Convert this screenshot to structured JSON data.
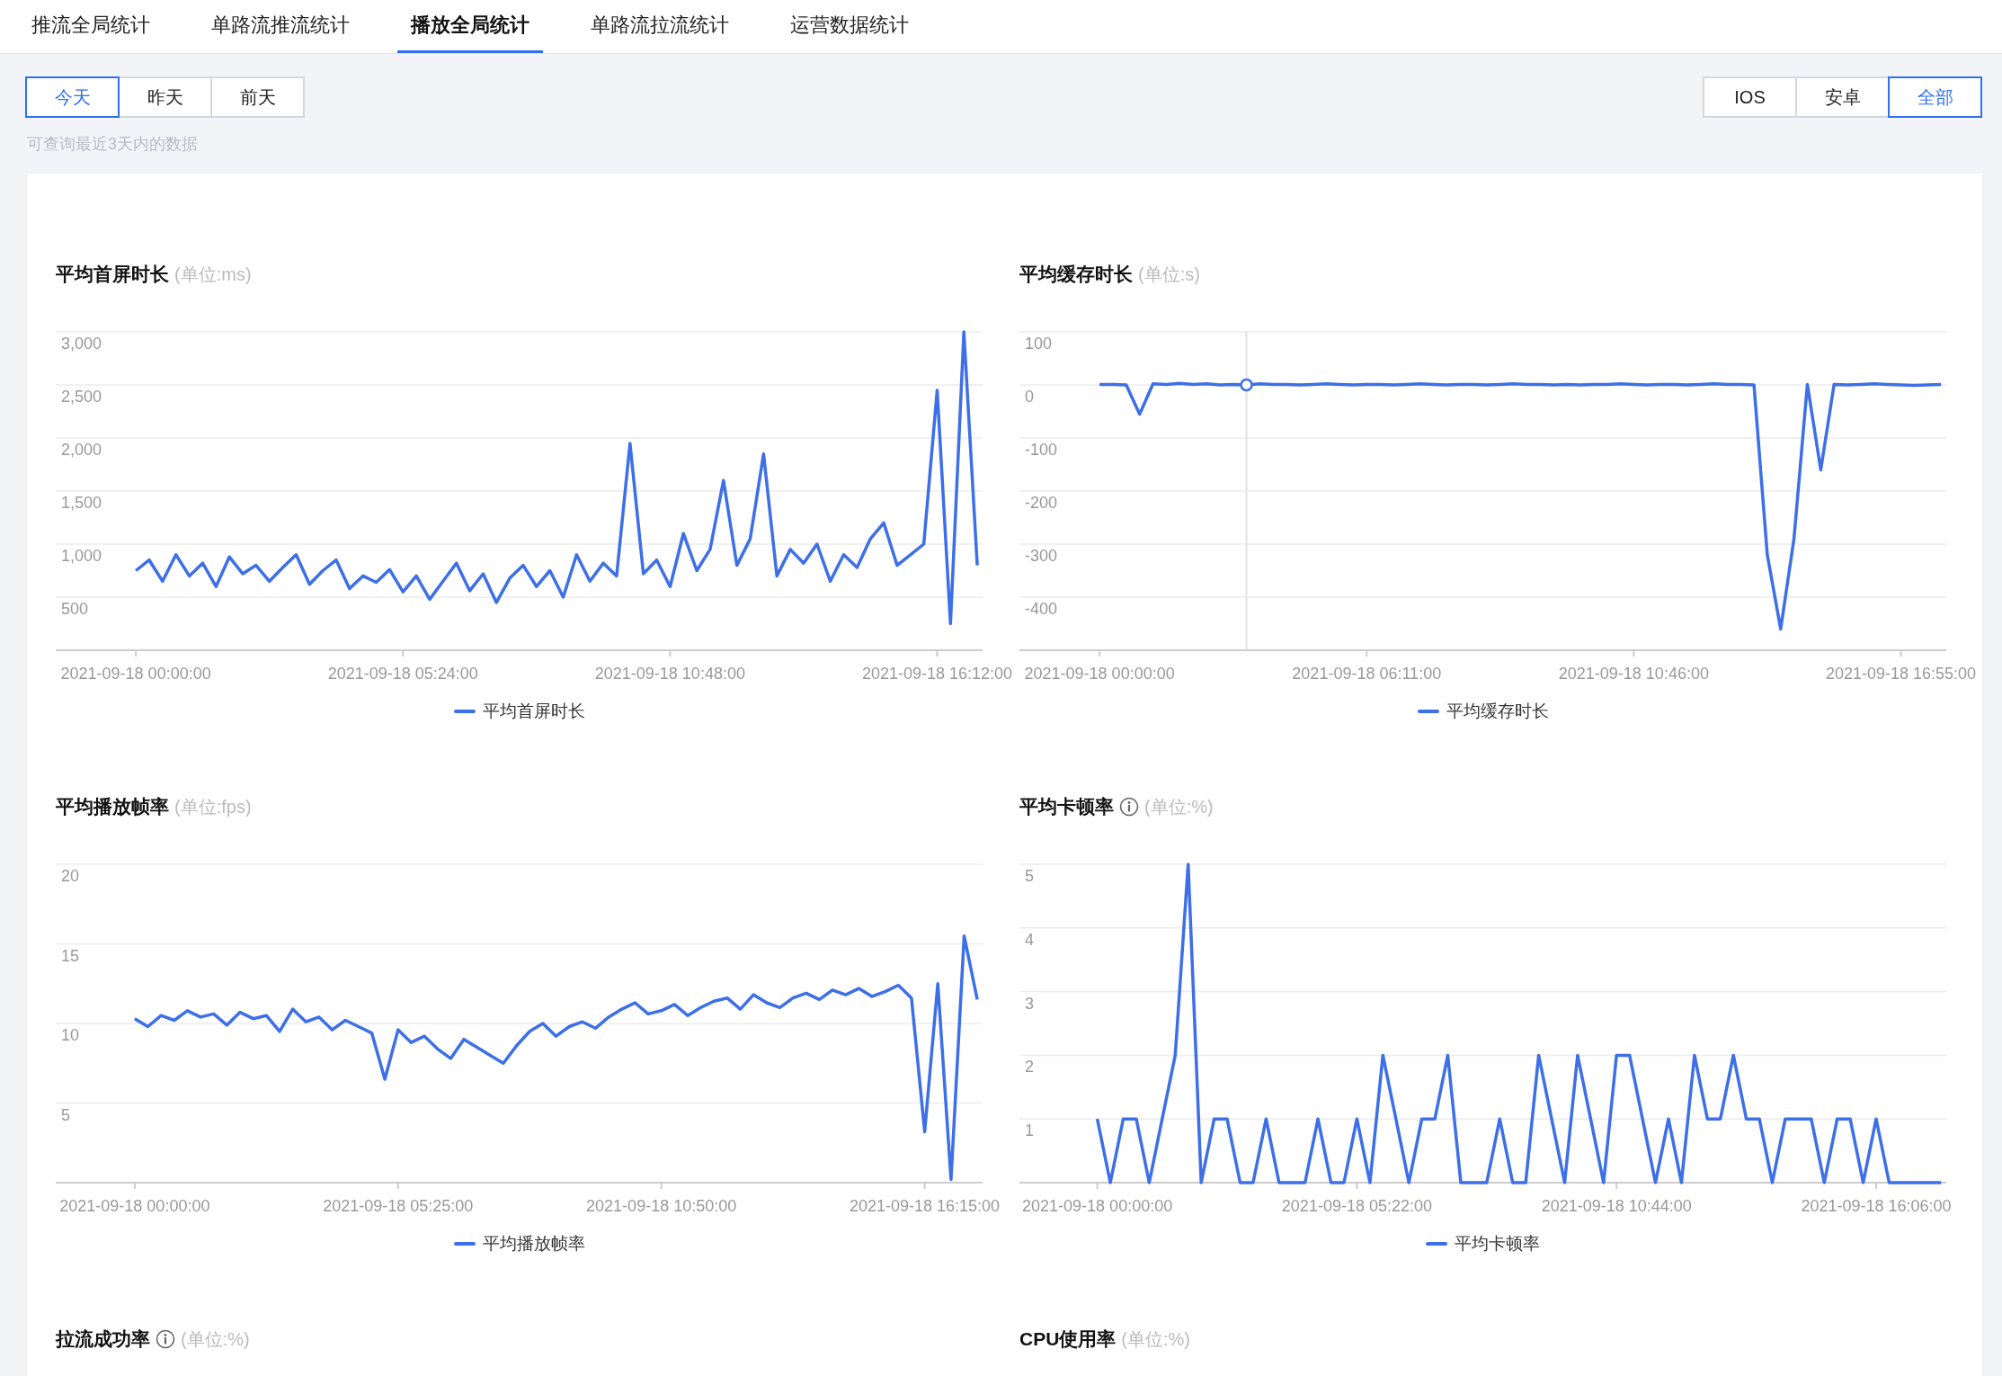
{
  "tabs": [
    {
      "label": "推流全局统计",
      "selected": false
    },
    {
      "label": "单路流推流统计",
      "selected": false
    },
    {
      "label": "播放全局统计",
      "selected": true
    },
    {
      "label": "单路流拉流统计",
      "selected": false
    },
    {
      "label": "运营数据统计",
      "selected": false
    }
  ],
  "day_filter": [
    {
      "label": "今天",
      "selected": true
    },
    {
      "label": "昨天",
      "selected": false
    },
    {
      "label": "前天",
      "selected": false
    }
  ],
  "platform_filter": [
    {
      "label": "IOS",
      "selected": false
    },
    {
      "label": "安卓",
      "selected": false
    },
    {
      "label": "全部",
      "selected": true
    }
  ],
  "hint": "可查询最近3天内的数据",
  "panels": [
    {
      "title": "平均首屏时长",
      "info": false,
      "unit": "(单位:ms)",
      "crosshair": false,
      "chart_data": {
        "type": "line",
        "grid": true,
        "ylim": [
          0,
          3000
        ],
        "yticks": [
          {
            "value": 500,
            "label": "500"
          },
          {
            "value": 1000,
            "label": "1,000"
          },
          {
            "value": 1500,
            "label": "1,500"
          },
          {
            "value": 2000,
            "label": "2,000"
          },
          {
            "value": 2500,
            "label": "2,500"
          },
          {
            "value": 3000,
            "label": "3,000"
          }
        ],
        "categories": [
          "2021-09-18 00:00:00",
          null,
          null,
          null,
          null,
          null,
          null,
          null,
          null,
          null,
          null,
          null,
          null,
          null,
          null,
          null,
          null,
          null,
          null,
          null,
          "2021-09-18 05:24:00",
          null,
          null,
          null,
          null,
          null,
          null,
          null,
          null,
          null,
          null,
          null,
          null,
          null,
          null,
          null,
          null,
          null,
          null,
          null,
          "2021-09-18 10:48:00",
          null,
          null,
          null,
          null,
          null,
          null,
          null,
          null,
          null,
          null,
          null,
          null,
          null,
          null,
          null,
          null,
          null,
          null,
          null,
          "2021-09-18 16:12:00",
          null,
          null,
          null
        ],
        "series": [
          {
            "name": "平均首屏时长",
            "color": "#3d6fe8",
            "values": [
              750,
              850,
              650,
              900,
              700,
              820,
              600,
              880,
              720,
              800,
              650,
              780,
              900,
              620,
              750,
              850,
              580,
              700,
              640,
              760,
              550,
              700,
              480,
              650,
              820,
              560,
              720,
              450,
              680,
              800,
              600,
              750,
              500,
              900,
              650,
              820,
              700,
              1950,
              720,
              850,
              600,
              1100,
              750,
              950,
              1600,
              800,
              1050,
              1850,
              700,
              950,
              820,
              1000,
              650,
              900,
              780,
              1050,
              1200,
              800,
              900,
              1000,
              2450,
              250,
              3000,
              800
            ]
          }
        ]
      }
    },
    {
      "title": "平均缓存时长",
      "info": false,
      "unit": "(单位:s)",
      "crosshair": true,
      "chart_data": {
        "type": "line",
        "ylim": [
          -500,
          100
        ],
        "yticks": [
          {
            "value": -400,
            "label": "-400"
          },
          {
            "value": -300,
            "label": "-300"
          },
          {
            "value": -200,
            "label": "-200"
          },
          {
            "value": -100,
            "label": "-100"
          },
          {
            "value": 0,
            "label": "0"
          },
          {
            "value": 100,
            "label": "100"
          }
        ],
        "categories": [
          "2021-09-18 00:00:00",
          null,
          null,
          null,
          null,
          null,
          null,
          null,
          null,
          null,
          null,
          null,
          null,
          null,
          null,
          null,
          null,
          null,
          null,
          null,
          "2021-09-18 06:11:00",
          null,
          null,
          null,
          null,
          null,
          null,
          null,
          null,
          null,
          null,
          null,
          null,
          null,
          null,
          null,
          null,
          null,
          null,
          null,
          "2021-09-18 10:46:00",
          null,
          null,
          null,
          null,
          null,
          null,
          null,
          null,
          null,
          null,
          null,
          null,
          null,
          null,
          null,
          null,
          null,
          null,
          null,
          "2021-09-18 16:55:00",
          null,
          null,
          null
        ],
        "grid": true,
        "series": [
          {
            "name": "平均缓存时长",
            "color": "#3d6fe8",
            "values": [
              1,
              1,
              0,
              -55,
              2,
              1,
              3,
              1,
              2,
              0,
              1,
              0,
              2,
              1,
              1,
              0,
              1,
              2,
              1,
              0,
              1,
              1,
              0,
              1,
              2,
              1,
              0,
              1,
              1,
              0,
              1,
              2,
              1,
              1,
              0,
              1,
              0,
              1,
              1,
              2,
              1,
              0,
              1,
              1,
              0,
              1,
              2,
              1,
              1,
              0,
              -320,
              -460,
              -290,
              1,
              -160,
              1,
              0,
              1,
              2,
              1,
              0,
              -1,
              0,
              1
            ]
          }
        ]
      }
    },
    {
      "title": "平均播放帧率",
      "info": false,
      "unit": "(单位:fps)",
      "crosshair": false,
      "chart_data": {
        "type": "line",
        "grid": true,
        "ylim": [
          0,
          20
        ],
        "yticks": [
          {
            "value": 5,
            "label": "5"
          },
          {
            "value": 10,
            "label": "10"
          },
          {
            "value": 15,
            "label": "15"
          },
          {
            "value": 20,
            "label": "20"
          }
        ],
        "categories": [
          "2021-09-18 00:00:00",
          null,
          null,
          null,
          null,
          null,
          null,
          null,
          null,
          null,
          null,
          null,
          null,
          null,
          null,
          null,
          null,
          null,
          null,
          null,
          "2021-09-18 05:25:00",
          null,
          null,
          null,
          null,
          null,
          null,
          null,
          null,
          null,
          null,
          null,
          null,
          null,
          null,
          null,
          null,
          null,
          null,
          null,
          "2021-09-18 10:50:00",
          null,
          null,
          null,
          null,
          null,
          null,
          null,
          null,
          null,
          null,
          null,
          null,
          null,
          null,
          null,
          null,
          null,
          null,
          null,
          "2021-09-18 16:15:00",
          null,
          null,
          null,
          null
        ],
        "series": [
          {
            "name": "平均播放帧率",
            "color": "#3d6fe8",
            "values": [
              10.3,
              9.8,
              10.5,
              10.2,
              10.8,
              10.4,
              10.6,
              9.9,
              10.7,
              10.3,
              10.5,
              9.5,
              10.9,
              10.1,
              10.4,
              9.6,
              10.2,
              9.8,
              9.4,
              6.5,
              9.6,
              8.8,
              9.2,
              8.4,
              7.8,
              9.0,
              8.5,
              8.0,
              7.5,
              8.6,
              9.5,
              10.0,
              9.2,
              9.8,
              10.1,
              9.7,
              10.4,
              10.9,
              11.3,
              10.6,
              10.8,
              11.2,
              10.5,
              11.0,
              11.4,
              11.6,
              10.9,
              11.8,
              11.3,
              11.0,
              11.6,
              11.9,
              11.5,
              12.1,
              11.8,
              12.2,
              11.7,
              12.0,
              12.4,
              11.6,
              3.2,
              12.5,
              0.2,
              15.5,
              11.5
            ]
          }
        ]
      }
    },
    {
      "title": "平均卡顿率",
      "info": true,
      "unit": "(单位:%)",
      "crosshair": false,
      "chart_data": {
        "type": "line",
        "grid": true,
        "ylim": [
          0,
          5
        ],
        "yticks": [
          {
            "value": 1,
            "label": "1"
          },
          {
            "value": 2,
            "label": "2"
          },
          {
            "value": 3,
            "label": "3"
          },
          {
            "value": 4,
            "label": "4"
          },
          {
            "value": 5,
            "label": "5"
          }
        ],
        "categories": [
          "2021-09-18 00:00:00",
          null,
          null,
          null,
          null,
          null,
          null,
          null,
          null,
          null,
          null,
          null,
          null,
          null,
          null,
          null,
          null,
          null,
          null,
          null,
          "2021-09-18 05:22:00",
          null,
          null,
          null,
          null,
          null,
          null,
          null,
          null,
          null,
          null,
          null,
          null,
          null,
          null,
          null,
          null,
          null,
          null,
          null,
          "2021-09-18 10:44:00",
          null,
          null,
          null,
          null,
          null,
          null,
          null,
          null,
          null,
          null,
          null,
          null,
          null,
          null,
          null,
          null,
          null,
          null,
          null,
          "2021-09-18 16:06:00",
          null,
          null,
          null,
          null,
          null
        ],
        "series": [
          {
            "name": "平均卡顿率",
            "color": "#3d6fe8",
            "values": [
              1,
              0,
              1,
              1,
              0,
              1,
              2,
              5,
              0,
              1,
              1,
              0,
              0,
              1,
              0,
              0,
              0,
              1,
              0,
              0,
              1,
              0,
              2,
              1,
              0,
              1,
              1,
              2,
              0,
              0,
              0,
              1,
              0,
              0,
              2,
              1,
              0,
              2,
              1,
              0,
              2,
              2,
              1,
              0,
              1,
              0,
              2,
              1,
              1,
              2,
              1,
              1,
              0,
              1,
              1,
              1,
              0,
              1,
              1,
              0,
              1,
              0,
              0,
              0,
              0,
              0
            ]
          }
        ]
      }
    },
    {
      "title": "拉流成功率",
      "info": true,
      "unit": "(单位:%)"
    },
    {
      "title": "CPU使用率",
      "info": false,
      "unit": "(单位:%)"
    }
  ]
}
